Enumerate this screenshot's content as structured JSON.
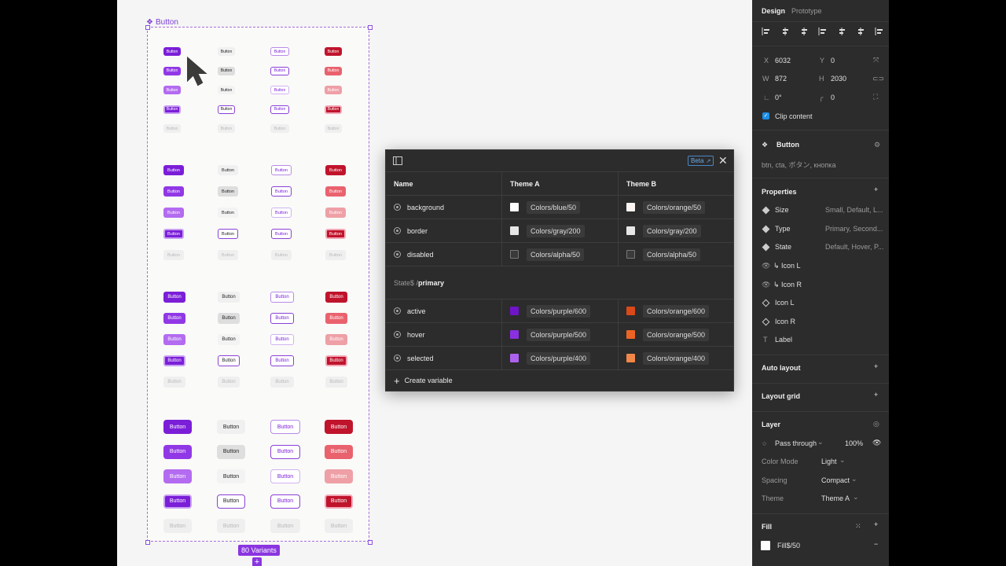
{
  "frame": {
    "label": "Button",
    "variants_badge": "80 Variants",
    "plus": "+",
    "button_text": "Button"
  },
  "colors": {
    "purple_600": "#7b1ed8",
    "purple_500": "#9138e6",
    "purple_400": "#b36bf0",
    "red_700": "#c0142c",
    "red_400": "#e9626e",
    "red_300": "#eea0a6"
  },
  "variables": {
    "beta": "Beta",
    "headers": [
      "Name",
      "Theme A",
      "Theme B"
    ],
    "rows": [
      {
        "name": "background",
        "a": "Colors/blue/50",
        "a_color": "#ffffff",
        "b": "Colors/orange/50",
        "b_color": "#fbf6f2"
      },
      {
        "name": "border",
        "a": "Colors/gray/200",
        "a_color": "#e6e6e6",
        "b": "Colors/gray/200",
        "b_color": "#e6e6e6"
      },
      {
        "name": "disabled",
        "a": "Colors/alpha/50",
        "a_color": "#3a3a3a",
        "b": "Colors/alpha/50",
        "b_color": "#3a3a3a"
      }
    ],
    "group_prefix": "State$ / ",
    "group_name": "primary",
    "group_rows": [
      {
        "name": "active",
        "a": "Colors/purple/600",
        "a_color": "#6f14c8",
        "b": "Colors/orange/600",
        "b_color": "#d9491a"
      },
      {
        "name": "hover",
        "a": "Colors/purple/500",
        "a_color": "#8a30e0",
        "b": "Colors/orange/500",
        "b_color": "#ec6424"
      },
      {
        "name": "selected",
        "a": "Colors/purple/400",
        "a_color": "#ad62ee",
        "b": "Colors/orange/400",
        "b_color": "#f28747"
      }
    ],
    "create": "Create variable"
  },
  "panel": {
    "tabs": [
      "Design",
      "Prototype"
    ],
    "x_label": "X",
    "x": "6032",
    "y_label": "Y",
    "y": "0",
    "w_label": "W",
    "w": "872",
    "h_label": "H",
    "h": "2030",
    "rotation": "0°",
    "radius": "0",
    "clip": "Clip content",
    "component_name": "Button",
    "component_desc": "btn, cta, ボタン, кнопка",
    "properties_title": "Properties",
    "props": [
      {
        "name": "Size",
        "value": "Small, Default, L..."
      },
      {
        "name": "Type",
        "value": "Primary, Second..."
      },
      {
        "name": "State",
        "value": "Default, Hover, P..."
      }
    ],
    "bool_props": [
      "↳ Icon L",
      "↳ Icon R"
    ],
    "instance_props": [
      "Icon L",
      "Icon R"
    ],
    "text_prop": "Label",
    "auto_layout": "Auto layout",
    "layout_grid": "Layout grid",
    "layer": "Layer",
    "blend": "Pass through",
    "opacity": "100%",
    "modes": [
      {
        "name": "Color Mode",
        "value": "Light"
      },
      {
        "name": "Spacing",
        "value": "Compact"
      },
      {
        "name": "Theme",
        "value": "Theme A"
      }
    ],
    "fill": "Fill",
    "fill_value": "Fill$/50",
    "plus": "+",
    "minus": "−"
  }
}
